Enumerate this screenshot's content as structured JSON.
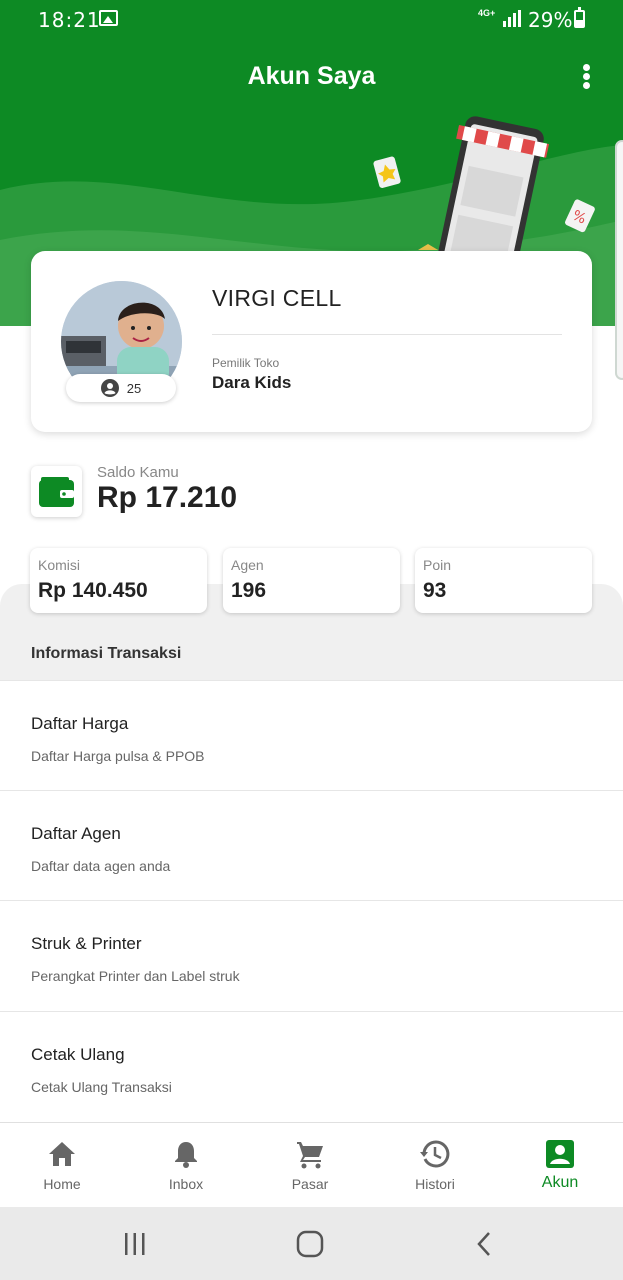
{
  "status_bar": {
    "time": "18:21",
    "network": "4G+",
    "battery_percent": "29%",
    "icons": [
      "gallery-icon",
      "signal-icon",
      "battery-icon"
    ]
  },
  "header": {
    "title": "Akun Saya",
    "menu_icon": "kebab-menu-icon",
    "brand_color": "#0d8a24"
  },
  "profile": {
    "store_name": "VIRGI CELL",
    "member_count": "25",
    "owner_label": "Pemilik Toko",
    "owner_name": "Dara Kids"
  },
  "balance": {
    "label": "Saldo Kamu",
    "value": "Rp 17.210",
    "icon": "wallet-icon"
  },
  "stats": [
    {
      "label": "Komisi",
      "value": "Rp 140.450"
    },
    {
      "label": "Agen",
      "value": "196"
    },
    {
      "label": "Poin",
      "value": "93"
    }
  ],
  "section": {
    "title": "Informasi Transaksi"
  },
  "menu": [
    {
      "title": "Daftar Harga",
      "subtitle": "Daftar Harga pulsa & PPOB"
    },
    {
      "title": "Daftar Agen",
      "subtitle": "Daftar data agen anda"
    },
    {
      "title": "Struk & Printer",
      "subtitle": "Perangkat Printer dan Label struk"
    },
    {
      "title": "Cetak Ulang",
      "subtitle": "Cetak Ulang Transaksi"
    }
  ],
  "bottom_nav": [
    {
      "label": "Home",
      "icon": "home-icon"
    },
    {
      "label": "Inbox",
      "icon": "bell-icon"
    },
    {
      "label": "Pasar",
      "icon": "cart-icon"
    },
    {
      "label": "Histori",
      "icon": "history-icon"
    },
    {
      "label": "Akun",
      "icon": "account-icon",
      "active": true
    }
  ],
  "colors": {
    "accent": "#0d8a24",
    "text": "#222222",
    "muted": "#888888"
  }
}
